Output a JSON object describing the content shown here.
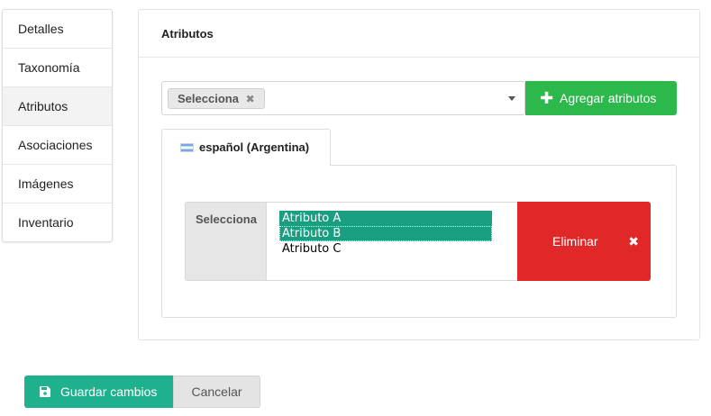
{
  "sidebar": {
    "items": [
      {
        "label": "Detalles"
      },
      {
        "label": "Taxonomía"
      },
      {
        "label": "Atributos"
      },
      {
        "label": "Asociaciones"
      },
      {
        "label": "Imágenes"
      },
      {
        "label": "Inventario"
      }
    ],
    "active": "Atributos"
  },
  "panel": {
    "title": "Atributos",
    "select": {
      "chip_label": "Selecciona",
      "chip_remove_icon": "x-icon"
    },
    "add_button": {
      "icon": "plus-icon",
      "label": "Agregar atributos"
    },
    "tab": {
      "flag_icon": "argentina-flag-icon",
      "label": "español (Argentina)"
    },
    "row": {
      "label": "Selecciona",
      "options": [
        "Atributo A",
        "Atributo B",
        "Atributo C"
      ],
      "selected": [
        "Atributo A",
        "Atributo B"
      ],
      "delete_button": {
        "label": "Eliminar",
        "icon": "x-icon"
      }
    }
  },
  "actions": {
    "save": {
      "icon": "floppy-disk-icon",
      "label": "Guardar cambios"
    },
    "cancel": {
      "label": "Cancelar"
    }
  },
  "colors": {
    "add_button": "#2db84c",
    "delete_button": "#e02828",
    "save_button": "#1fb08d",
    "option_selected": "#1a9e80"
  }
}
